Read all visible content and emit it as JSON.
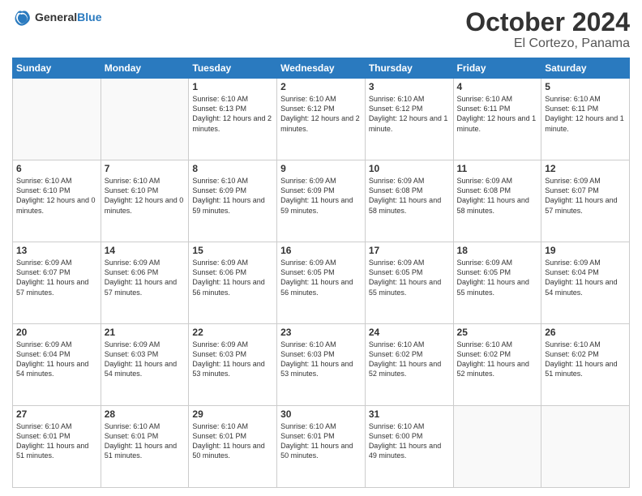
{
  "header": {
    "logo_general": "General",
    "logo_blue": "Blue",
    "month": "October 2024",
    "location": "El Cortezo, Panama"
  },
  "days_of_week": [
    "Sunday",
    "Monday",
    "Tuesday",
    "Wednesday",
    "Thursday",
    "Friday",
    "Saturday"
  ],
  "weeks": [
    [
      {
        "day": "",
        "info": ""
      },
      {
        "day": "",
        "info": ""
      },
      {
        "day": "1",
        "info": "Sunrise: 6:10 AM\nSunset: 6:13 PM\nDaylight: 12 hours\nand 2 minutes."
      },
      {
        "day": "2",
        "info": "Sunrise: 6:10 AM\nSunset: 6:12 PM\nDaylight: 12 hours\nand 2 minutes."
      },
      {
        "day": "3",
        "info": "Sunrise: 6:10 AM\nSunset: 6:12 PM\nDaylight: 12 hours\nand 1 minute."
      },
      {
        "day": "4",
        "info": "Sunrise: 6:10 AM\nSunset: 6:11 PM\nDaylight: 12 hours\nand 1 minute."
      },
      {
        "day": "5",
        "info": "Sunrise: 6:10 AM\nSunset: 6:11 PM\nDaylight: 12 hours\nand 1 minute."
      }
    ],
    [
      {
        "day": "6",
        "info": "Sunrise: 6:10 AM\nSunset: 6:10 PM\nDaylight: 12 hours\nand 0 minutes."
      },
      {
        "day": "7",
        "info": "Sunrise: 6:10 AM\nSunset: 6:10 PM\nDaylight: 12 hours\nand 0 minutes."
      },
      {
        "day": "8",
        "info": "Sunrise: 6:10 AM\nSunset: 6:09 PM\nDaylight: 11 hours\nand 59 minutes."
      },
      {
        "day": "9",
        "info": "Sunrise: 6:09 AM\nSunset: 6:09 PM\nDaylight: 11 hours\nand 59 minutes."
      },
      {
        "day": "10",
        "info": "Sunrise: 6:09 AM\nSunset: 6:08 PM\nDaylight: 11 hours\nand 58 minutes."
      },
      {
        "day": "11",
        "info": "Sunrise: 6:09 AM\nSunset: 6:08 PM\nDaylight: 11 hours\nand 58 minutes."
      },
      {
        "day": "12",
        "info": "Sunrise: 6:09 AM\nSunset: 6:07 PM\nDaylight: 11 hours\nand 57 minutes."
      }
    ],
    [
      {
        "day": "13",
        "info": "Sunrise: 6:09 AM\nSunset: 6:07 PM\nDaylight: 11 hours\nand 57 minutes."
      },
      {
        "day": "14",
        "info": "Sunrise: 6:09 AM\nSunset: 6:06 PM\nDaylight: 11 hours\nand 57 minutes."
      },
      {
        "day": "15",
        "info": "Sunrise: 6:09 AM\nSunset: 6:06 PM\nDaylight: 11 hours\nand 56 minutes."
      },
      {
        "day": "16",
        "info": "Sunrise: 6:09 AM\nSunset: 6:05 PM\nDaylight: 11 hours\nand 56 minutes."
      },
      {
        "day": "17",
        "info": "Sunrise: 6:09 AM\nSunset: 6:05 PM\nDaylight: 11 hours\nand 55 minutes."
      },
      {
        "day": "18",
        "info": "Sunrise: 6:09 AM\nSunset: 6:05 PM\nDaylight: 11 hours\nand 55 minutes."
      },
      {
        "day": "19",
        "info": "Sunrise: 6:09 AM\nSunset: 6:04 PM\nDaylight: 11 hours\nand 54 minutes."
      }
    ],
    [
      {
        "day": "20",
        "info": "Sunrise: 6:09 AM\nSunset: 6:04 PM\nDaylight: 11 hours\nand 54 minutes."
      },
      {
        "day": "21",
        "info": "Sunrise: 6:09 AM\nSunset: 6:03 PM\nDaylight: 11 hours\nand 54 minutes."
      },
      {
        "day": "22",
        "info": "Sunrise: 6:09 AM\nSunset: 6:03 PM\nDaylight: 11 hours\nand 53 minutes."
      },
      {
        "day": "23",
        "info": "Sunrise: 6:10 AM\nSunset: 6:03 PM\nDaylight: 11 hours\nand 53 minutes."
      },
      {
        "day": "24",
        "info": "Sunrise: 6:10 AM\nSunset: 6:02 PM\nDaylight: 11 hours\nand 52 minutes."
      },
      {
        "day": "25",
        "info": "Sunrise: 6:10 AM\nSunset: 6:02 PM\nDaylight: 11 hours\nand 52 minutes."
      },
      {
        "day": "26",
        "info": "Sunrise: 6:10 AM\nSunset: 6:02 PM\nDaylight: 11 hours\nand 51 minutes."
      }
    ],
    [
      {
        "day": "27",
        "info": "Sunrise: 6:10 AM\nSunset: 6:01 PM\nDaylight: 11 hours\nand 51 minutes."
      },
      {
        "day": "28",
        "info": "Sunrise: 6:10 AM\nSunset: 6:01 PM\nDaylight: 11 hours\nand 51 minutes."
      },
      {
        "day": "29",
        "info": "Sunrise: 6:10 AM\nSunset: 6:01 PM\nDaylight: 11 hours\nand 50 minutes."
      },
      {
        "day": "30",
        "info": "Sunrise: 6:10 AM\nSunset: 6:01 PM\nDaylight: 11 hours\nand 50 minutes."
      },
      {
        "day": "31",
        "info": "Sunrise: 6:10 AM\nSunset: 6:00 PM\nDaylight: 11 hours\nand 49 minutes."
      },
      {
        "day": "",
        "info": ""
      },
      {
        "day": "",
        "info": ""
      }
    ]
  ]
}
